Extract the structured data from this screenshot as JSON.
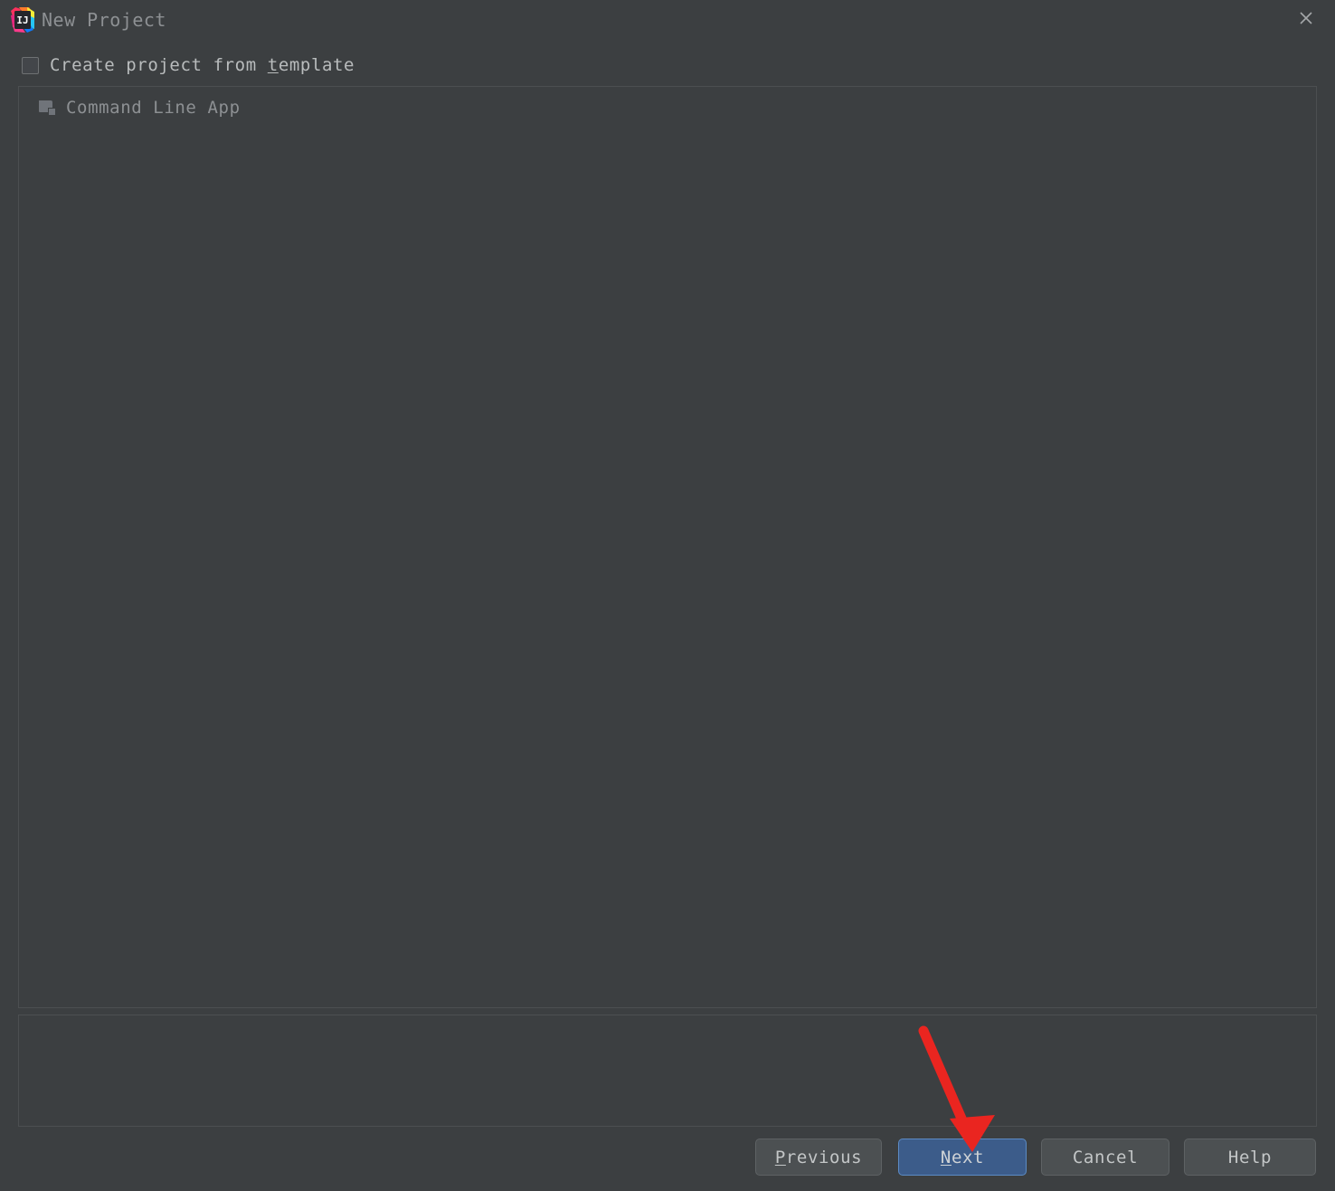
{
  "window": {
    "title": "New Project",
    "logo_icon": "intellij-idea-logo",
    "close_icon": "close-icon"
  },
  "options": {
    "create_from_template": {
      "label_prefix": "Create project from ",
      "label_mnemonic": "t",
      "label_suffix": "emplate",
      "checked": false
    }
  },
  "template_tree": {
    "items": [
      {
        "label": "Command Line App",
        "icon": "folder-icon",
        "enabled": false
      }
    ]
  },
  "description_panel": {
    "text": ""
  },
  "buttons": {
    "previous": {
      "mnemonic": "P",
      "rest": "revious"
    },
    "next": {
      "mnemonic": "N",
      "rest": "ext",
      "primary": true
    },
    "cancel": {
      "label": "Cancel"
    },
    "help": {
      "label": "Help"
    }
  },
  "annotation": {
    "arrow_color": "#ea2520",
    "points_to": "next-button"
  },
  "colors": {
    "background": "#3c3f41",
    "panel_border": "#4c4f51",
    "text_muted": "#8d9093",
    "text_normal": "#b9bcbd",
    "button_face": "#4c5052",
    "button_primary": "#3c5c8a",
    "button_primary_border": "#5c8bc4",
    "accent_red": "#ea2520"
  }
}
